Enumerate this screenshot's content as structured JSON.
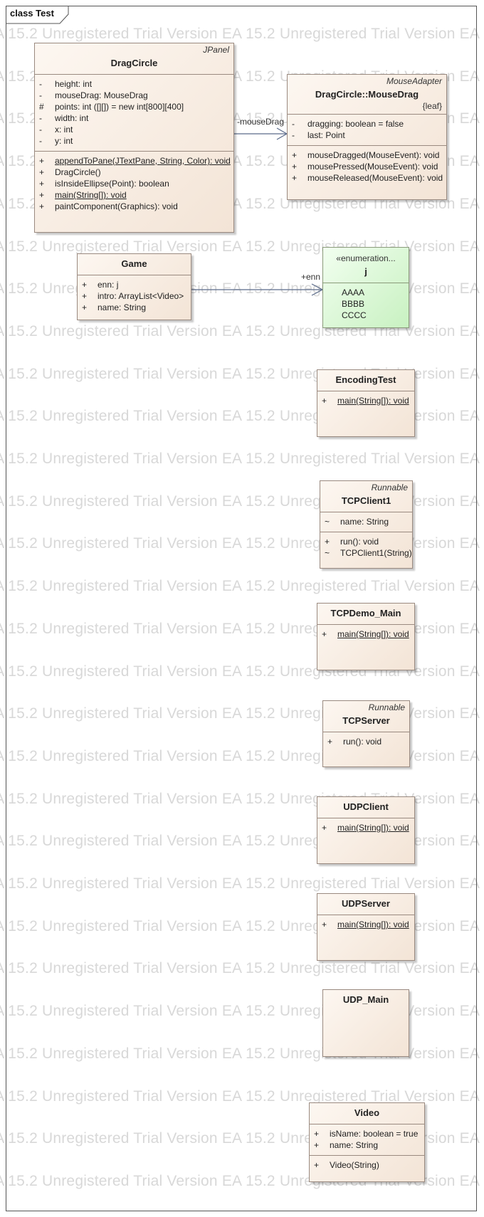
{
  "frame": {
    "title": "class Test"
  },
  "watermark": {
    "text": "EA 15.2 Unregistered Trial Version EA 15.2 Unregistered Trial Version EA 15.2 Unregistered Trial Version"
  },
  "relations": {
    "dragcircle_to_mousedrag": {
      "role": "-mouseDrag"
    },
    "game_to_j": {
      "role": "+enn"
    }
  },
  "classes": {
    "dragcircle": {
      "stereotype": "JPanel",
      "name": "DragCircle",
      "attributes": [
        {
          "vis": "-",
          "text": "height: int",
          "static": false
        },
        {
          "vis": "-",
          "text": "mouseDrag: MouseDrag",
          "static": false
        },
        {
          "vis": "#",
          "text": "points: int ([][]) = new int[800][400]",
          "static": false
        },
        {
          "vis": "-",
          "text": "width: int",
          "static": false
        },
        {
          "vis": "-",
          "text": "x: int",
          "static": false
        },
        {
          "vis": "-",
          "text": "y: int",
          "static": false
        }
      ],
      "operations": [
        {
          "vis": "+",
          "text": "appendToPane(JTextPane, String, Color): void",
          "static": true
        },
        {
          "vis": "+",
          "text": "DragCircle()",
          "static": false
        },
        {
          "vis": "+",
          "text": "isInsideEllipse(Point): boolean",
          "static": false
        },
        {
          "vis": "+",
          "text": "main(String[]): void",
          "static": true
        },
        {
          "vis": "+",
          "text": "paintComponent(Graphics): void",
          "static": false
        }
      ]
    },
    "mousedrag": {
      "stereotype": "MouseAdapter",
      "name": "DragCircle::MouseDrag",
      "tag": "{leaf}",
      "attributes": [
        {
          "vis": "-",
          "text": "dragging: boolean = false",
          "static": false
        },
        {
          "vis": "-",
          "text": "last: Point",
          "static": false
        }
      ],
      "operations": [
        {
          "vis": "+",
          "text": "mouseDragged(MouseEvent): void",
          "static": false
        },
        {
          "vis": "+",
          "text": "mousePressed(MouseEvent): void",
          "static": false
        },
        {
          "vis": "+",
          "text": "mouseReleased(MouseEvent): void",
          "static": false
        }
      ]
    },
    "game": {
      "name": "Game",
      "attributes": [
        {
          "vis": "+",
          "text": "enn: j",
          "static": false
        },
        {
          "vis": "+",
          "text": "intro: ArrayList<Video>",
          "static": false
        },
        {
          "vis": "+",
          "text": "name: String",
          "static": false
        }
      ]
    },
    "j": {
      "stereotype": "«enumeration...",
      "name": "j",
      "literals": [
        "AAAA",
        "BBBB",
        "CCCC"
      ]
    },
    "encodingtest": {
      "name": "EncodingTest",
      "operations": [
        {
          "vis": "+",
          "text": "main(String[]): void",
          "static": true
        }
      ]
    },
    "tcpclient1": {
      "stereotype": "Runnable",
      "name": "TCPClient1",
      "attributes": [
        {
          "vis": "~",
          "text": "name: String",
          "static": false
        }
      ],
      "operations": [
        {
          "vis": "+",
          "text": "run(): void",
          "static": false
        },
        {
          "vis": "~",
          "text": "TCPClient1(String)",
          "static": false
        }
      ]
    },
    "tcpdemo_main": {
      "name": "TCPDemo_Main",
      "operations": [
        {
          "vis": "+",
          "text": "main(String[]): void",
          "static": true
        }
      ]
    },
    "tcpserver": {
      "stereotype": "Runnable",
      "name": "TCPServer",
      "operations": [
        {
          "vis": "+",
          "text": "run(): void",
          "static": false
        }
      ]
    },
    "udpclient": {
      "name": "UDPClient",
      "operations": [
        {
          "vis": "+",
          "text": "main(String[]): void",
          "static": true
        }
      ]
    },
    "udpserver": {
      "name": "UDPServer",
      "operations": [
        {
          "vis": "+",
          "text": "main(String[]): void",
          "static": true
        }
      ]
    },
    "udp_main": {
      "name": "UDP_Main"
    },
    "video": {
      "name": "Video",
      "attributes": [
        {
          "vis": "+",
          "text": "isName: boolean = true",
          "static": false
        },
        {
          "vis": "+",
          "text": "name: String",
          "static": false
        }
      ],
      "operations": [
        {
          "vis": "+",
          "text": "Video(String)",
          "static": false
        }
      ]
    }
  }
}
